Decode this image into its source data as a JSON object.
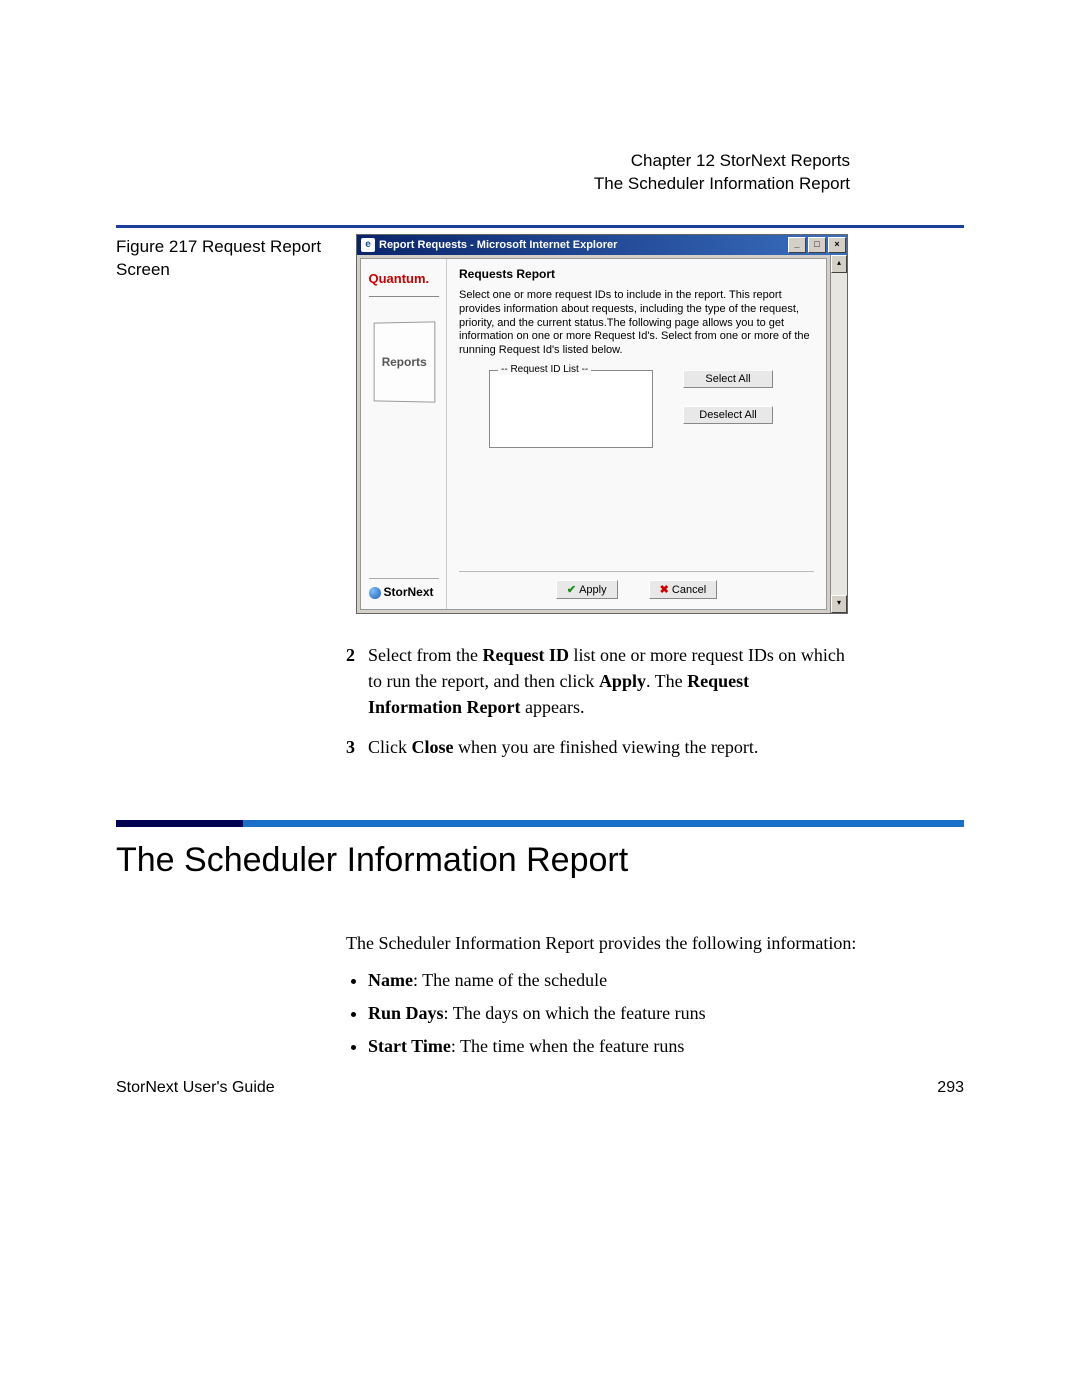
{
  "header": {
    "chapter": "Chapter 12  StorNext Reports",
    "section": "The Scheduler Information Report"
  },
  "figure": {
    "caption": "Figure 217  Request Report Screen"
  },
  "window": {
    "title": "Report Requests - Microsoft Internet Explorer",
    "minimize": "_",
    "maximize": "□",
    "close": "×",
    "scroll_up": "▴",
    "scroll_down": "▾"
  },
  "sidebar": {
    "brand": "Quantum.",
    "reports_label": "Reports",
    "product": "StorNext"
  },
  "panel": {
    "title": "Requests Report",
    "description": "Select one or more request IDs to include in the report. This report provides information about requests, including the type of the request, priority, and the current status.The following page allows you to get information on one or more Request Id's. Select from one or more of the running Request Id's listed below.",
    "list_legend": "-- Request ID List --",
    "select_all": "Select All",
    "deselect_all": "Deselect All",
    "apply": "Apply",
    "cancel": "Cancel"
  },
  "steps": {
    "s2_num": "2",
    "s2_a": "Select from the ",
    "s2_b": "Request ID",
    "s2_c": " list one or more request IDs on which to run the report, and then click ",
    "s2_d": "Apply",
    "s2_e": ". The ",
    "s2_f": "Request Information Report",
    "s2_g": " appears.",
    "s3_num": "3",
    "s3_a": "Click ",
    "s3_b": "Close",
    "s3_c": " when you are finished viewing the report."
  },
  "section": {
    "heading": "The Scheduler Information Report",
    "intro": "The Scheduler Information Report provides the following information:",
    "b1_a": "Name",
    "b1_b": ": The name of the schedule",
    "b2_a": "Run Days",
    "b2_b": ": The days on which the feature runs",
    "b3_a": "Start Time",
    "b3_b": ": The time when the feature runs"
  },
  "footer": {
    "left": "StorNext User's Guide",
    "right": "293"
  }
}
